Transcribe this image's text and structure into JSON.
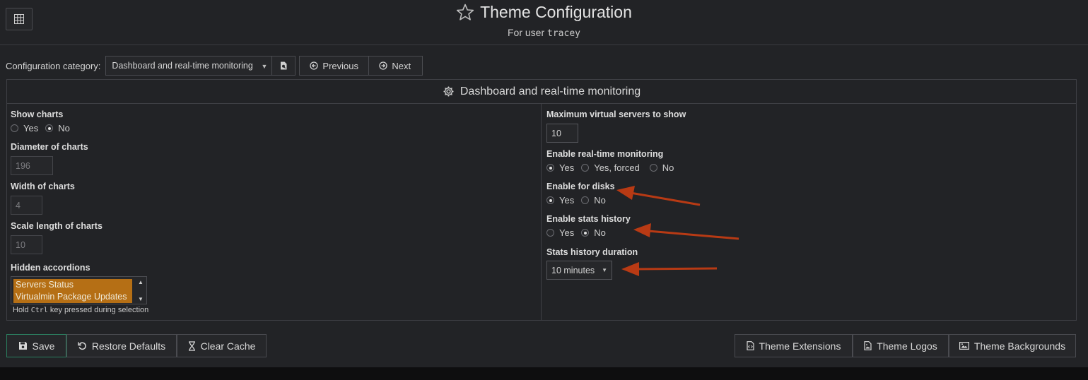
{
  "header": {
    "title": "Theme Configuration",
    "subtitle_prefix": "For user",
    "username": "tracey"
  },
  "category": {
    "label": "Configuration category:",
    "selected": "Dashboard and real-time monitoring",
    "prev_label": "Previous",
    "next_label": "Next"
  },
  "panel": {
    "title": "Dashboard and real-time monitoring",
    "left": {
      "show_charts": {
        "label": "Show charts",
        "yes": "Yes",
        "no": "No",
        "selected": "No"
      },
      "diameter": {
        "label": "Diameter of charts",
        "value": "196"
      },
      "width": {
        "label": "Width of charts",
        "value": "4"
      },
      "scale": {
        "label": "Scale length of charts",
        "value": "10"
      },
      "hidden_accordions": {
        "label": "Hidden accordions",
        "options": [
          "Servers Status",
          "Virtualmin Package Updates"
        ],
        "hint_prefix": "Hold",
        "hint_key": "Ctrl",
        "hint_suffix": "key pressed during selection"
      }
    },
    "right": {
      "max_servers": {
        "label": "Maximum virtual servers to show",
        "value": "10"
      },
      "realtime": {
        "label": "Enable real-time monitoring",
        "yes": "Yes",
        "forced": "Yes, forced",
        "no": "No",
        "selected": "Yes"
      },
      "disks": {
        "label": "Enable for disks",
        "yes": "Yes",
        "no": "No",
        "selected": "Yes"
      },
      "stats_history": {
        "label": "Enable stats history",
        "yes": "Yes",
        "no": "No",
        "selected": "No"
      },
      "history_duration": {
        "label": "Stats history duration",
        "value": "10 minutes"
      }
    }
  },
  "buttons": {
    "save": "Save",
    "restore": "Restore Defaults",
    "clear_cache": "Clear Cache",
    "extensions": "Theme Extensions",
    "logos": "Theme Logos",
    "backgrounds": "Theme Backgrounds"
  },
  "colors": {
    "background": "#222326",
    "annotation_arrow": "#b83a14",
    "selected_option": "#b56f15",
    "save_border": "#2b7f60"
  }
}
